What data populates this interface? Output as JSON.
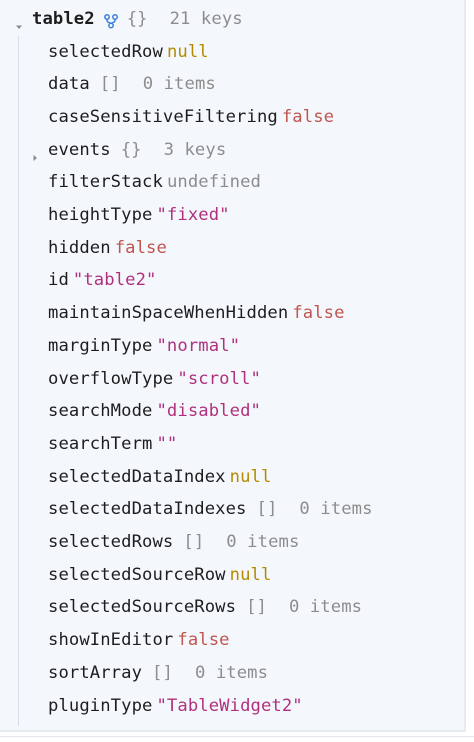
{
  "root": {
    "name": "table2",
    "braces": "{}",
    "count_label": "21 keys",
    "icons": {
      "expand": "chevron-down-icon",
      "branch": "branch-icon"
    }
  },
  "rows": [
    {
      "key": "selectedRow",
      "value": "null",
      "kind": "null"
    },
    {
      "key": "data",
      "value": "[]",
      "extra": "0 items",
      "kind": "array"
    },
    {
      "key": "caseSensitiveFiltering",
      "value": "false",
      "kind": "false"
    },
    {
      "key": "events",
      "value": "{}",
      "extra": "3 keys",
      "kind": "object",
      "collapsed": true
    },
    {
      "key": "filterStack",
      "value": "undefined",
      "kind": "undef"
    },
    {
      "key": "heightType",
      "value": "\"fixed\"",
      "kind": "str"
    },
    {
      "key": "hidden",
      "value": "false",
      "kind": "false"
    },
    {
      "key": "id",
      "value": "\"table2\"",
      "kind": "str"
    },
    {
      "key": "maintainSpaceWhenHidden",
      "value": "false",
      "kind": "false"
    },
    {
      "key": "marginType",
      "value": "\"normal\"",
      "kind": "str"
    },
    {
      "key": "overflowType",
      "value": "\"scroll\"",
      "kind": "str"
    },
    {
      "key": "searchMode",
      "value": "\"disabled\"",
      "kind": "str"
    },
    {
      "key": "searchTerm",
      "value": "\"\"",
      "kind": "str"
    },
    {
      "key": "selectedDataIndex",
      "value": "null",
      "kind": "null"
    },
    {
      "key": "selectedDataIndexes",
      "value": "[]",
      "extra": "0 items",
      "kind": "array"
    },
    {
      "key": "selectedRows",
      "value": "[]",
      "extra": "0 items",
      "kind": "array"
    },
    {
      "key": "selectedSourceRow",
      "value": "null",
      "kind": "null"
    },
    {
      "key": "selectedSourceRows",
      "value": "[]",
      "extra": "0 items",
      "kind": "array"
    },
    {
      "key": "showInEditor",
      "value": "false",
      "kind": "false"
    },
    {
      "key": "sortArray",
      "value": "[]",
      "extra": "0 items",
      "kind": "array"
    },
    {
      "key": "pluginType",
      "value": "\"TableWidget2\"",
      "kind": "str"
    }
  ],
  "colors": {
    "background": "#f4f8fd",
    "key": "#1d1d1d",
    "null": "#b58a00",
    "false": "#c0554e",
    "string": "#b0307e",
    "meta": "#8c8c8c",
    "branch_icon": "#3d7fd8"
  }
}
